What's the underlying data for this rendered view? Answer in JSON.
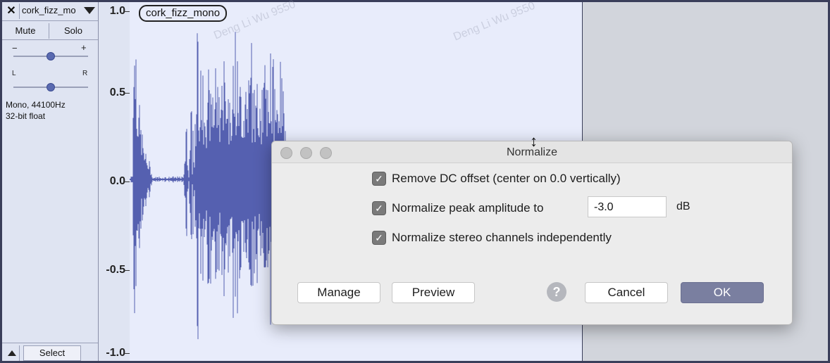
{
  "track": {
    "name": "cork_fizz_mo",
    "mute_label": "Mute",
    "solo_label": "Solo",
    "gain_minus": "−",
    "gain_plus": "+",
    "pan_left": "L",
    "pan_right": "R",
    "gain_level": 0.5,
    "pan_level": 0.5,
    "info_line1": "Mono, 44100Hz",
    "info_line2": "32-bit float",
    "select_label": "Select"
  },
  "ruler": {
    "labels": [
      "1.0",
      "0.5",
      "0.0",
      "-0.5",
      "-1.0"
    ]
  },
  "clip": {
    "name": "cork_fizz_mono"
  },
  "watermark": {
    "text": "Deng Li Wu 9550"
  },
  "dialog": {
    "title": "Normalize",
    "remove_dc_label": "Remove DC offset (center on 0.0 vertically)",
    "remove_dc_checked": true,
    "normalize_peak_label": "Normalize peak amplitude to",
    "normalize_peak_checked": true,
    "peak_value": "-3.0",
    "peak_unit": "dB",
    "stereo_label": "Normalize stereo channels independently",
    "stereo_checked": true,
    "manage_label": "Manage",
    "preview_label": "Preview",
    "help_label": "?",
    "cancel_label": "Cancel",
    "ok_label": "OK"
  },
  "colors": {
    "waveform": "#5560b0",
    "ok_button": "#7a7fa0"
  }
}
